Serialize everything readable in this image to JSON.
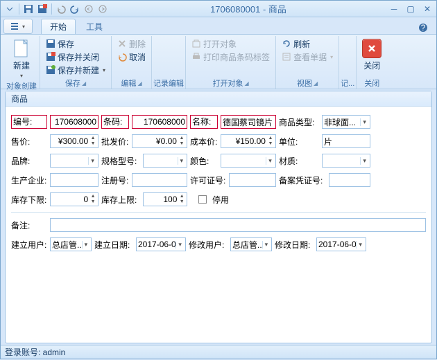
{
  "window": {
    "title": "1706080001 - 商品"
  },
  "tabs": {
    "start": "开始",
    "tools": "工具"
  },
  "ribbon": {
    "new": "新建",
    "new_group": "对象创建",
    "save": "保存",
    "save_close": "保存并关闭",
    "save_new": "保存并新建",
    "save_group": "保存",
    "delete": "删除",
    "cancel": "取消",
    "edit_group": "编辑",
    "record_edit": "记录编辑",
    "open_obj": "打开对象",
    "print_barcode": "打印商品条码标签",
    "open_group": "打开对象",
    "refresh": "刷新",
    "view_form": "查看单据",
    "view_group": "视图",
    "log_group": "记...",
    "close": "关闭",
    "close_group": "关闭"
  },
  "panel": {
    "title": "商品"
  },
  "labels": {
    "code": "编号:",
    "barcode": "条码:",
    "name": "名称:",
    "category": "商品类型:",
    "price": "售价:",
    "wholesale": "批发价:",
    "cost": "成本价:",
    "unit": "单位:",
    "brand": "品牌:",
    "spec": "规格型号:",
    "color": "颜色:",
    "material": "材质:",
    "manufacturer": "生产企业:",
    "regno": "注册号:",
    "license": "许可证号:",
    "recordno": "备案凭证号:",
    "stock_min": "库存下限:",
    "stock_max": "库存上限:",
    "disabled": "停用",
    "remark": "备注:",
    "create_user": "建立用户:",
    "create_date": "建立日期:",
    "modify_user": "修改用户:",
    "modify_date": "修改日期:"
  },
  "values": {
    "code": "170608000",
    "barcode": "170608000",
    "name": "德国蔡司镜片",
    "category": "非球面...",
    "price": "¥300.00",
    "wholesale": "¥0.00",
    "cost": "¥150.00",
    "unit": "片",
    "brand": "",
    "spec": "",
    "color": "",
    "material": "",
    "manufacturer": "",
    "regno": "",
    "license": "",
    "recordno": "",
    "stock_min": "0",
    "stock_max": "100",
    "remark": "",
    "create_user": "总店管...",
    "create_date": "2017-06-0",
    "modify_user": "总店管...",
    "modify_date": "2017-06-0"
  },
  "status": {
    "login_prefix": "登录账号: ",
    "login_user": "admin"
  }
}
